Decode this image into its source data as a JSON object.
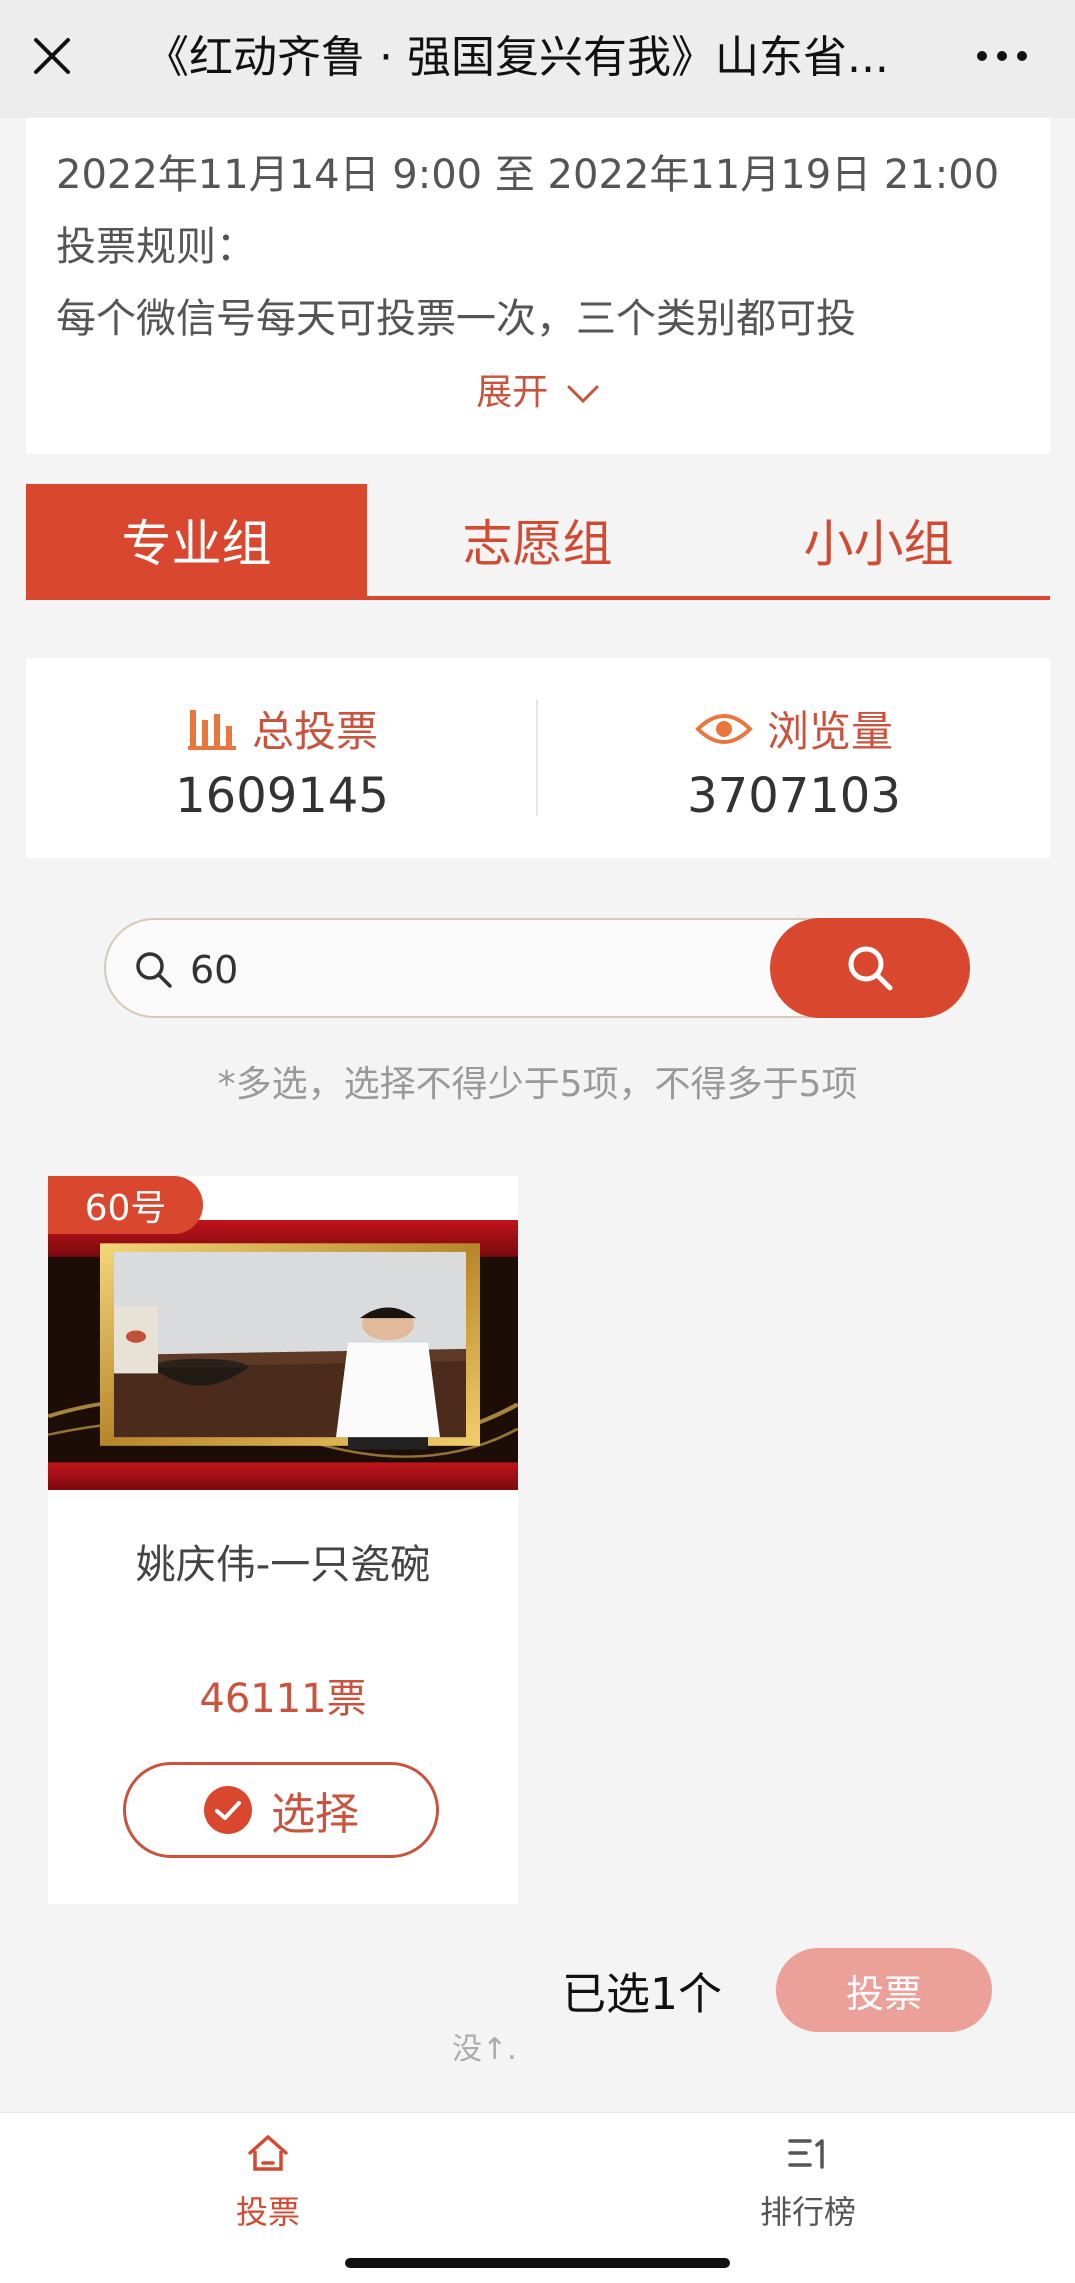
{
  "topbar": {
    "title": "《红动齐鲁 · 强国复兴有我》山东省...",
    "close_icon": "close-icon",
    "more_icon": "more-icon"
  },
  "info": {
    "time_range": "2022年11月14日 9:00 至 2022年11月19日 21:00",
    "rules_title": "投票规则：",
    "rules_text": "每个微信号每天可投票一次，三个类别都可投",
    "expand_label": "展开"
  },
  "tabs": [
    {
      "label": "专业组",
      "active": true
    },
    {
      "label": "志愿组",
      "active": false
    },
    {
      "label": "小小组",
      "active": false
    }
  ],
  "stats": {
    "total_votes_label": "总投票",
    "total_votes_value": "1609145",
    "views_label": "浏览量",
    "views_value": "3707103"
  },
  "search": {
    "value": "60",
    "placeholder": ""
  },
  "hint": "*多选，选择不得少于5项，不得多于5项",
  "entry": {
    "badge": "60号",
    "name": "姚庆伟-一只瓷碗",
    "votes": "46111票",
    "select_label": "选择"
  },
  "footer_bar": {
    "selected_text": "已选1个",
    "vote_button": "投票",
    "noscroll_text": "没↑."
  },
  "bottom_nav": [
    {
      "label": "投票",
      "icon": "home-icon",
      "active": true
    },
    {
      "label": "排行榜",
      "icon": "ranking-icon",
      "active": false
    }
  ],
  "colors": {
    "accent": "#d9472f",
    "accent_text": "#c9533c",
    "vote_disabled": "#eba199"
  }
}
